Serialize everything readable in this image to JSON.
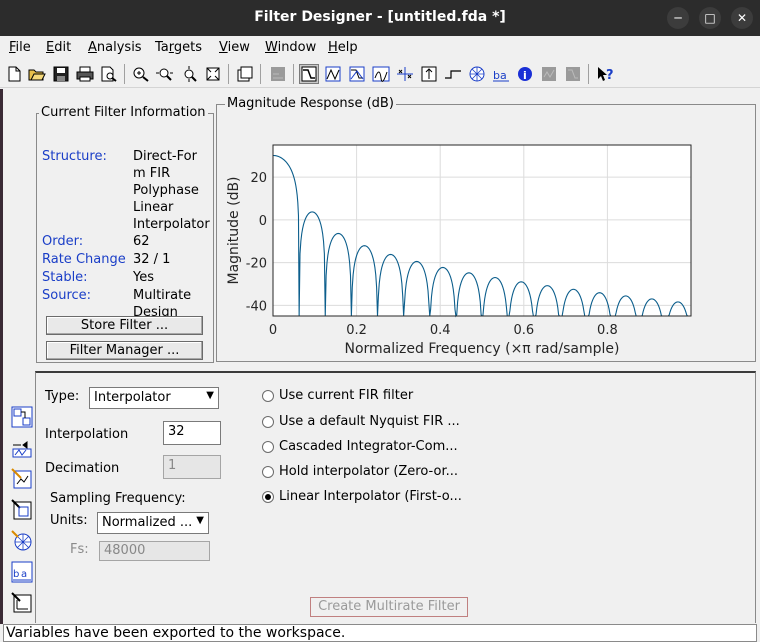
{
  "window": {
    "title": "Filter Designer -  [untitled.fda *]",
    "minimize_glyph": "─",
    "maximize_glyph": "□",
    "close_glyph": "✕"
  },
  "menu": [
    {
      "pre": "",
      "ul": "F",
      "post": "ile"
    },
    {
      "pre": "",
      "ul": "E",
      "post": "dit"
    },
    {
      "pre": "",
      "ul": "A",
      "post": "nalysis"
    },
    {
      "pre": "Ta",
      "ul": "r",
      "post": "gets"
    },
    {
      "pre": "",
      "ul": "V",
      "post": "iew"
    },
    {
      "pre": "",
      "ul": "W",
      "post": "indow"
    },
    {
      "pre": "",
      "ul": "H",
      "post": "elp"
    }
  ],
  "toolbar_icons": [
    "new-icon",
    "open-icon",
    "save-icon",
    "print-icon",
    "print-preview-icon",
    "zoom-in-icon",
    "zoom-x-icon",
    "zoom-y-icon",
    "full-view-icon",
    "new-window-icon",
    "disabled-icon",
    "magnitude-response-icon",
    "phase-response-icon",
    "magnitude-phase-icon",
    "group-delay-icon",
    "pole-zero-icon",
    "impulse-response-icon",
    "step-response-icon",
    "filter-coefficients-icon",
    "filter-info-icon",
    "info-icon",
    "disabled-icon-2",
    "disabled-icon-3",
    "whats-this-icon"
  ],
  "filter_info": {
    "group_title": "Current Filter Information",
    "rows": [
      {
        "label": "Structure:",
        "value_lines": [
          "Direct-For",
          "m FIR",
          "Polyphase",
          "Linear",
          "Interpolator"
        ]
      },
      {
        "label": "Order:",
        "value_lines": [
          "62"
        ]
      },
      {
        "label": "Rate Change",
        "value_lines": [
          "32 / 1"
        ]
      },
      {
        "label": "Stable:",
        "value_lines": [
          "Yes"
        ]
      },
      {
        "label": "Source:",
        "value_lines": [
          "Multirate",
          "Design"
        ]
      }
    ],
    "store_button": "Store Filter ...",
    "manager_button": "Filter Manager ..."
  },
  "plot": {
    "group_title": "Magnitude Response (dB)",
    "ylabel": "Magnitude (dB)",
    "xlabel": "Normalized Frequency  (×π rad/sample)",
    "xticks": [
      "0",
      "0.2",
      "0.4",
      "0.6",
      "0.8"
    ],
    "yticks": [
      "20",
      "0",
      "-20",
      "-40"
    ],
    "line_color": "#0c5e8c"
  },
  "chart_data": {
    "type": "line",
    "title": "",
    "xlabel": "Normalized Frequency  (×π rad/sample)",
    "ylabel": "Magnitude (dB)",
    "xlim": [
      0,
      1
    ],
    "ylim": [
      -45,
      35
    ],
    "series": [
      {
        "x": [
          0,
          0.03125,
          0.09375,
          0.15625,
          0.21875,
          0.28125,
          0.34375,
          0.40625,
          0.46875,
          0.53125,
          0.59375,
          0.65625,
          0.71875,
          0.78125,
          0.84375,
          0.90625,
          0.96875
        ],
        "values": [
          30.1,
          21,
          3.7,
          -6.4,
          -12.1,
          -16.2,
          -19.5,
          -22.3,
          -24.8,
          -27.0,
          -29.0,
          -30.8,
          -32.5,
          -34.1,
          -35.6,
          -37.0,
          -38.4
        ]
      }
    ]
  },
  "side_icons": [
    "transform-filter-icon",
    "multirate-filter-icon",
    "realize-model-icon",
    "import-filter-icon",
    "pole-zero-editor-icon",
    "design-filter-icon",
    "filter-tools-icon"
  ],
  "multirate": {
    "type_label": "Type:",
    "type_value": "Interpolator",
    "interpolation_label": "Interpolation",
    "interpolation_value": "32",
    "decimation_label": "Decimation",
    "decimation_value": "1",
    "sampling_label": "Sampling Frequency:",
    "units_label": "Units:",
    "units_value": "Normalized ...",
    "fs_label": "Fs:",
    "fs_value": "48000",
    "options": [
      {
        "label": "Use current FIR filter",
        "selected": false
      },
      {
        "label": "Use a default Nyquist FIR ...",
        "selected": false
      },
      {
        "label": "Cascaded Integrator-Com...",
        "selected": false
      },
      {
        "label": "Hold interpolator (Zero-or...",
        "selected": false
      },
      {
        "label": "Linear Interpolator (First-o...",
        "selected": true
      }
    ],
    "create_button": "Create Multirate Filter"
  },
  "status": "Variables have been exported to the workspace."
}
